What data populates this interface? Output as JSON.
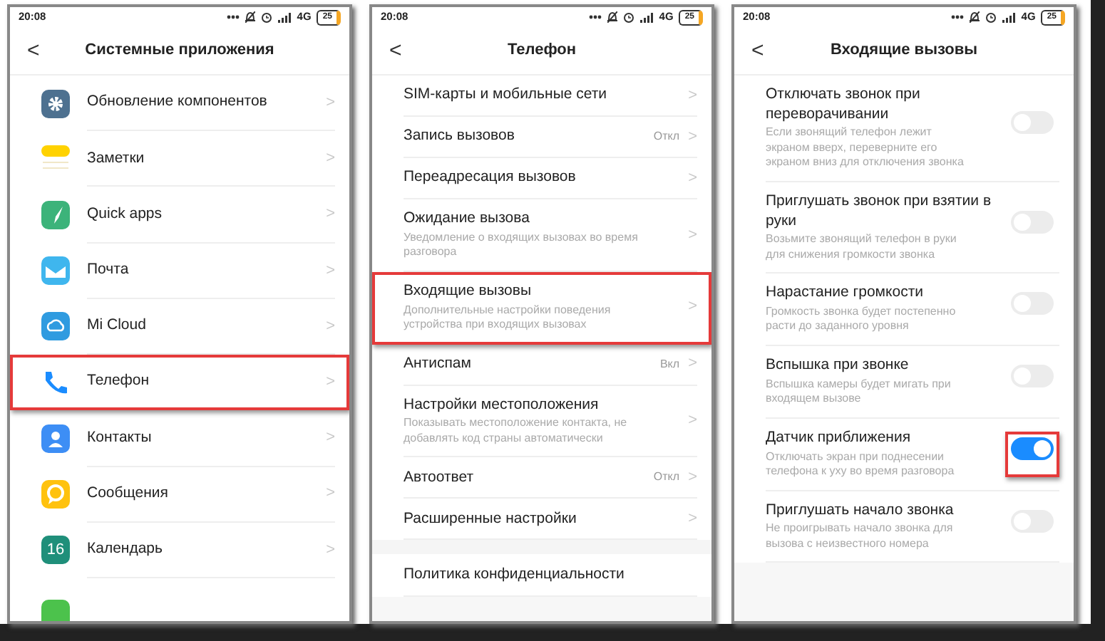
{
  "screens": [
    {
      "status": {
        "time": "20:08",
        "network": "4G",
        "battery": "25"
      },
      "title": "Системные приложения",
      "back": "<",
      "items": [
        {
          "kind": "app",
          "label": "Обновление компонентов",
          "chevron": ">",
          "highlighted": false
        },
        {
          "kind": "app",
          "label": "Заметки",
          "chevron": ">",
          "highlighted": false
        },
        {
          "kind": "app",
          "label": "Quick apps",
          "chevron": ">",
          "highlighted": false
        },
        {
          "kind": "app",
          "label": "Почта",
          "chevron": ">",
          "highlighted": false
        },
        {
          "kind": "app",
          "label": "Mi Cloud",
          "chevron": ">",
          "highlighted": false
        },
        {
          "kind": "app",
          "label": "Телефон",
          "chevron": ">",
          "highlighted": true
        },
        {
          "kind": "app",
          "label": "Контакты",
          "chevron": ">",
          "highlighted": false
        },
        {
          "kind": "app",
          "label": "Сообщения",
          "chevron": ">",
          "highlighted": false
        },
        {
          "kind": "app",
          "label": "Календарь",
          "icon_text": "16",
          "chevron": ">",
          "highlighted": false
        }
      ]
    },
    {
      "status": {
        "time": "20:08",
        "network": "4G",
        "battery": "25"
      },
      "title": "Телефон",
      "back": "<",
      "items": [
        {
          "kind": "link",
          "label": "SIM-карты и мобильные сети",
          "chevron": ">",
          "highlighted": false
        },
        {
          "kind": "link",
          "label": "Запись вызовов",
          "value": "Откл",
          "chevron": ">",
          "highlighted": false
        },
        {
          "kind": "link",
          "label": "Переадресация вызовов",
          "chevron": ">",
          "highlighted": false
        },
        {
          "kind": "link",
          "label": "Ожидание вызова",
          "description": "Уведомление о входящих вызовах во время разговора",
          "chevron": ">",
          "highlighted": false
        },
        {
          "kind": "link",
          "label": "Входящие вызовы",
          "description": "Дополнительные настройки поведения устройства при входящих вызовах",
          "chevron": ">",
          "highlighted": true
        },
        {
          "kind": "link",
          "label": "Антиспам",
          "value": "Вкл",
          "chevron": ">",
          "highlighted": false
        },
        {
          "kind": "link",
          "label": "Настройки местоположения",
          "description": "Показывать местоположение контакта, не добавлять код страны автоматически",
          "chevron": ">",
          "highlighted": false
        },
        {
          "kind": "link",
          "label": "Автоответ",
          "value": "Откл",
          "chevron": ">",
          "highlighted": false
        },
        {
          "kind": "link",
          "label": "Расширенные настройки",
          "chevron": ">",
          "highlighted": false
        },
        {
          "kind": "section",
          "label": "Политика конфиденциальности",
          "highlighted": false
        }
      ]
    },
    {
      "status": {
        "time": "20:08",
        "network": "4G",
        "battery": "25"
      },
      "title": "Входящие вызовы",
      "back": "<",
      "items": [
        {
          "kind": "toggle",
          "label": "Отключать звонок при переворачивании",
          "description": "Если звонящий телефон лежит экраном вверх, переверните его экраном вниз для отключения звонка",
          "checked": false,
          "highlighted": false
        },
        {
          "kind": "toggle",
          "label": "Приглушать звонок при взятии в руки",
          "description": "Возьмите звонящий телефон в руки для снижения громкости звонка",
          "checked": false,
          "highlighted": false
        },
        {
          "kind": "toggle",
          "label": "Нарастание громкости",
          "description": "Громкость звонка будет постепенно расти до заданного уровня",
          "checked": false,
          "highlighted": false
        },
        {
          "kind": "toggle",
          "label": "Вспышка при звонке",
          "description": "Вспышка камеры будет мигать при входящем вызове",
          "checked": false,
          "highlighted": false
        },
        {
          "kind": "toggle",
          "label": "Датчик приближения",
          "description": "Отключать экран при поднесении телефона к уху во время разговора",
          "checked": true,
          "highlighted": true
        },
        {
          "kind": "toggle",
          "label": "Приглушать начало звонка",
          "description": "Не проигрывать начало звонка для вызова с неизвестного номера",
          "checked": false,
          "highlighted": false
        }
      ]
    }
  ]
}
